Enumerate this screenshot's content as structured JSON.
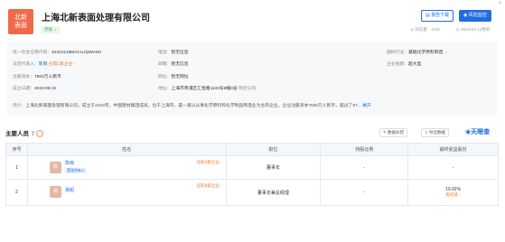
{
  "logo": {
    "line1": "北新",
    "line2": "表面"
  },
  "company": {
    "name": "上海北新表面处理有限公司",
    "status": "存续"
  },
  "header": {
    "close_glyph": "×",
    "report_button": "报告下载",
    "risk_button": "风险监控",
    "views": "◎ 浏览量：1134",
    "updated": "◷ 2024-02-12更新"
  },
  "info": {
    "credit_code_label": "统一社会信用代码：",
    "credit_code": "91310118MACUJQWA8H",
    "legal_rep_label": "法定代表人：",
    "legal_rep": "陈雨",
    "legal_rep_tag": "任职1家企业",
    "reg_capital_label": "注册资本：",
    "reg_capital": "7500万人民币",
    "established_label": "成立日期：",
    "established": "2023-08-22",
    "phone_label": "电话：",
    "phone": "暂无信息",
    "email_label": "邮箱：",
    "email": "暂无信息",
    "website_label": "网址：",
    "website": "暂无网址",
    "address_label": "地址：",
    "address": "上海市青浦区汇金路1133号8幢4层",
    "address_link": "附近公司",
    "industry_label": "国标行业：",
    "industry": "基础化学原料制造",
    "scale_label": "企业规模：",
    "scale": "超大型",
    "intro_label": "简介：",
    "intro": "上海北新表面处理有限公司，成立于2023年，中国建材集团成员，位于上海市，是一家以从事化学原料和化学制品制造业为主的企业。企业注册资本7500万人民币，超过了97...",
    "expand": "展开"
  },
  "members": {
    "title": "主要人员",
    "count": "7",
    "data_download": "数据纠错",
    "export": "导出数据",
    "brand": "天眼查",
    "columns": [
      "序号",
      "姓名",
      "职位",
      "持股比例",
      "最终受益股份"
    ],
    "rows": [
      {
        "index": "1",
        "avatar": "陈",
        "name": "陈雨",
        "badge": "受益所有人",
        "tenure": "任职3家企业",
        "position": "董事长",
        "share": "-",
        "benefit": "-",
        "benefit_link": ""
      },
      {
        "index": "2",
        "avatar": "易",
        "name": "易昭",
        "badge": "",
        "tenure": "任职8家企业",
        "position": "董事长兼总经理",
        "share": "-",
        "benefit": "19.92%",
        "benefit_link": "股权链"
      }
    ]
  }
}
